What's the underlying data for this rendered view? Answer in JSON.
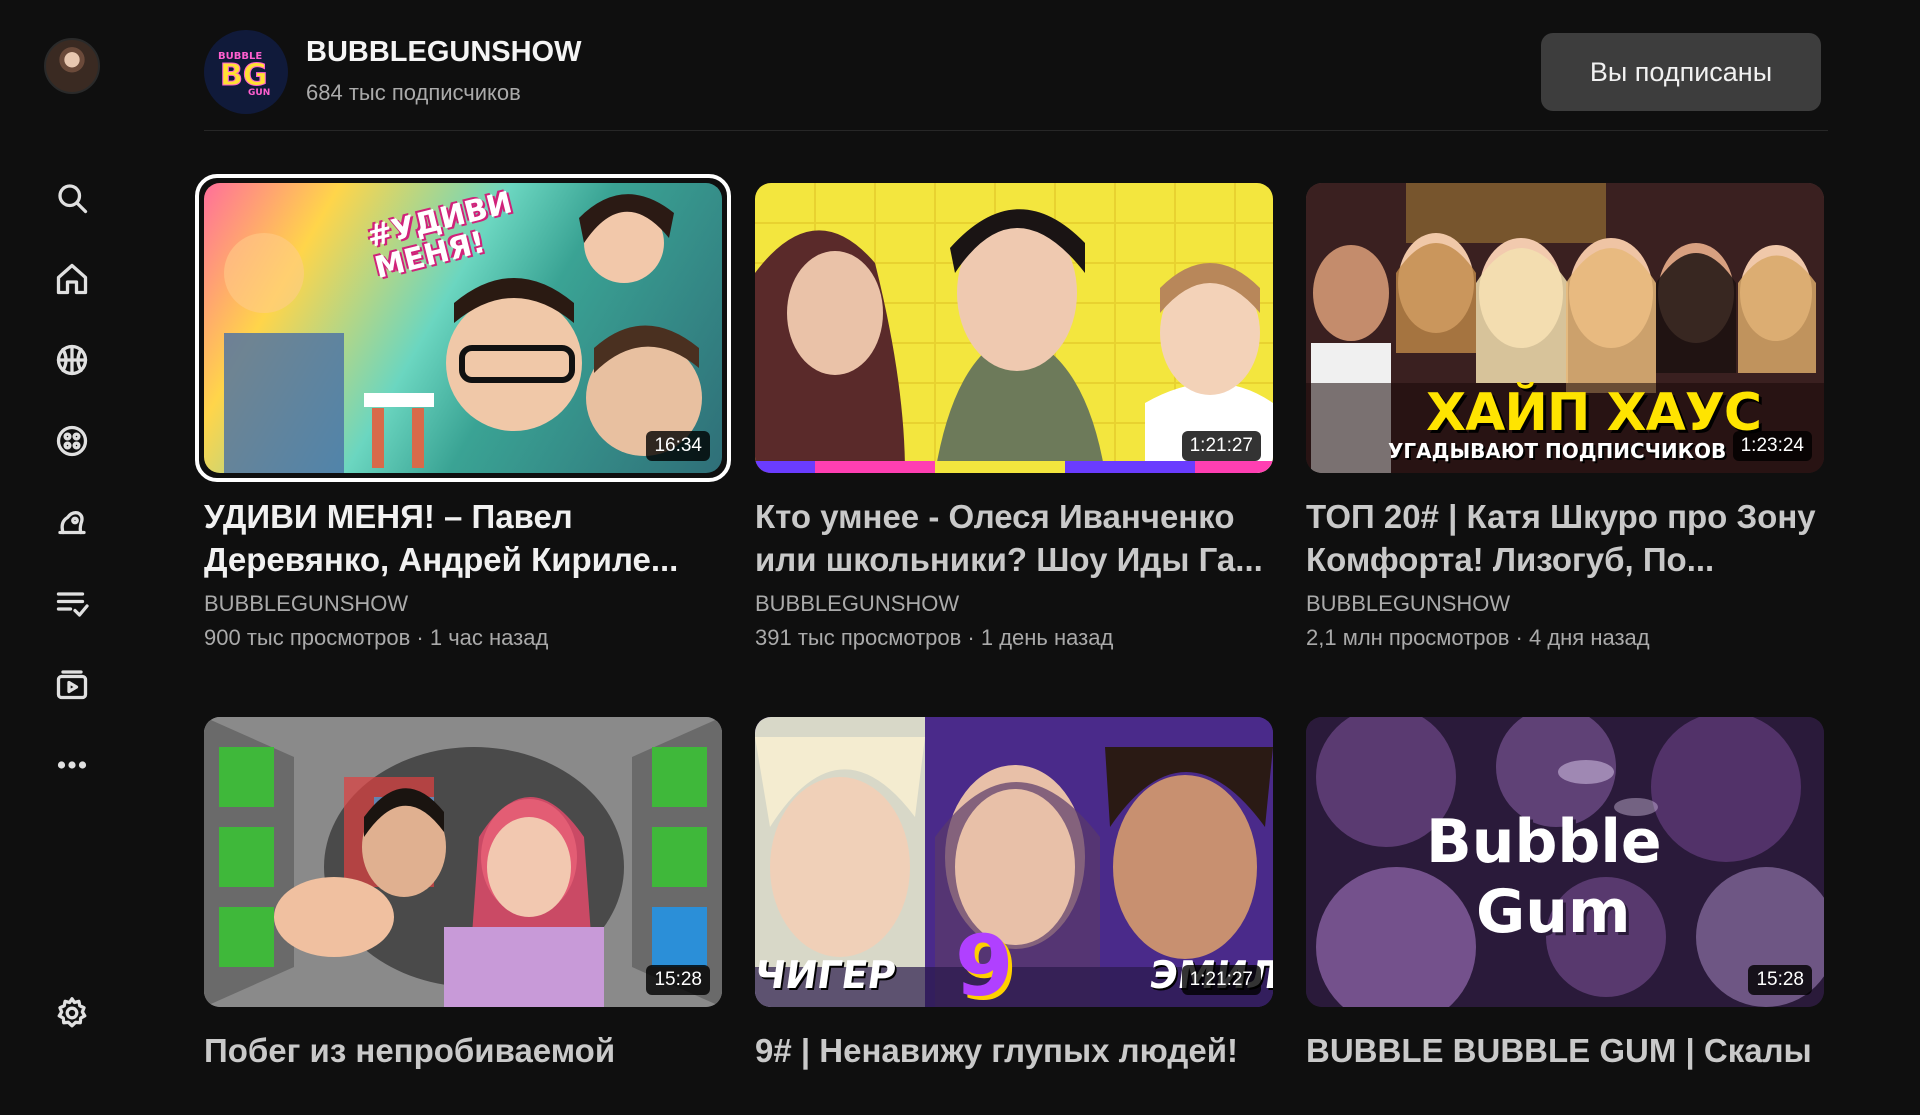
{
  "channel": {
    "logo_text": "BUBBLE BG GUN",
    "name": "BUBBLEGUNSHOW",
    "subscribers": "684 тыс подписчиков",
    "subscribe_label": "Вы подписаны"
  },
  "sidebar": {
    "items": [
      {
        "icon": "search-icon"
      },
      {
        "icon": "home-icon"
      },
      {
        "icon": "sports-icon"
      },
      {
        "icon": "gaming-icon"
      },
      {
        "icon": "music-icon"
      },
      {
        "icon": "playlist-icon"
      },
      {
        "icon": "subscriptions-icon"
      },
      {
        "icon": "more-icon"
      }
    ],
    "settings_icon": "gear-icon"
  },
  "videos": [
    {
      "title": "УДИВИ МЕНЯ! – Павел Деревянко, Андрей Кириле...",
      "channel": "BUBBLEGUNSHOW",
      "stats": "900 тыс просмотров · 1 час назад",
      "duration": "16:34",
      "thumb_text": "#УДИВИ МЕНЯ!"
    },
    {
      "title": "Кто умнее - Олеся Иванченко или школьники? Шоу Иды Га...",
      "channel": "BUBBLEGUNSHOW",
      "stats": "391 тыс просмотров · 1 день назад",
      "duration": "1:21:27",
      "thumb_text": ""
    },
    {
      "title": "ТОП 20# | Катя Шкуро про Зону Комфорта! Лизогуб, По...",
      "channel": "BUBBLEGUNSHOW",
      "stats": "2,1 млн просмотров · 4 дня назад",
      "duration": "1:23:24",
      "thumb_text": "ХАЙП ХАУС",
      "thumb_subtext": "УГАДЫВАЮТ ПОДПИСЧИКОВ"
    },
    {
      "title": "Побег из непробиваемой",
      "channel": "",
      "stats": "",
      "duration": "15:28",
      "thumb_text": ""
    },
    {
      "title": "9# | Ненавижу глупых людей!",
      "channel": "",
      "stats": "",
      "duration": "1:21:27",
      "thumb_text": "9",
      "thumb_left": "ЧИГЕР",
      "thumb_right": "ЭМИЛ"
    },
    {
      "title": "BUBBLE BUBBLE GUM | Скалы",
      "channel": "",
      "stats": "",
      "duration": "15:28",
      "thumb_text": "Bubble",
      "thumb_text2": "Gum"
    }
  ]
}
